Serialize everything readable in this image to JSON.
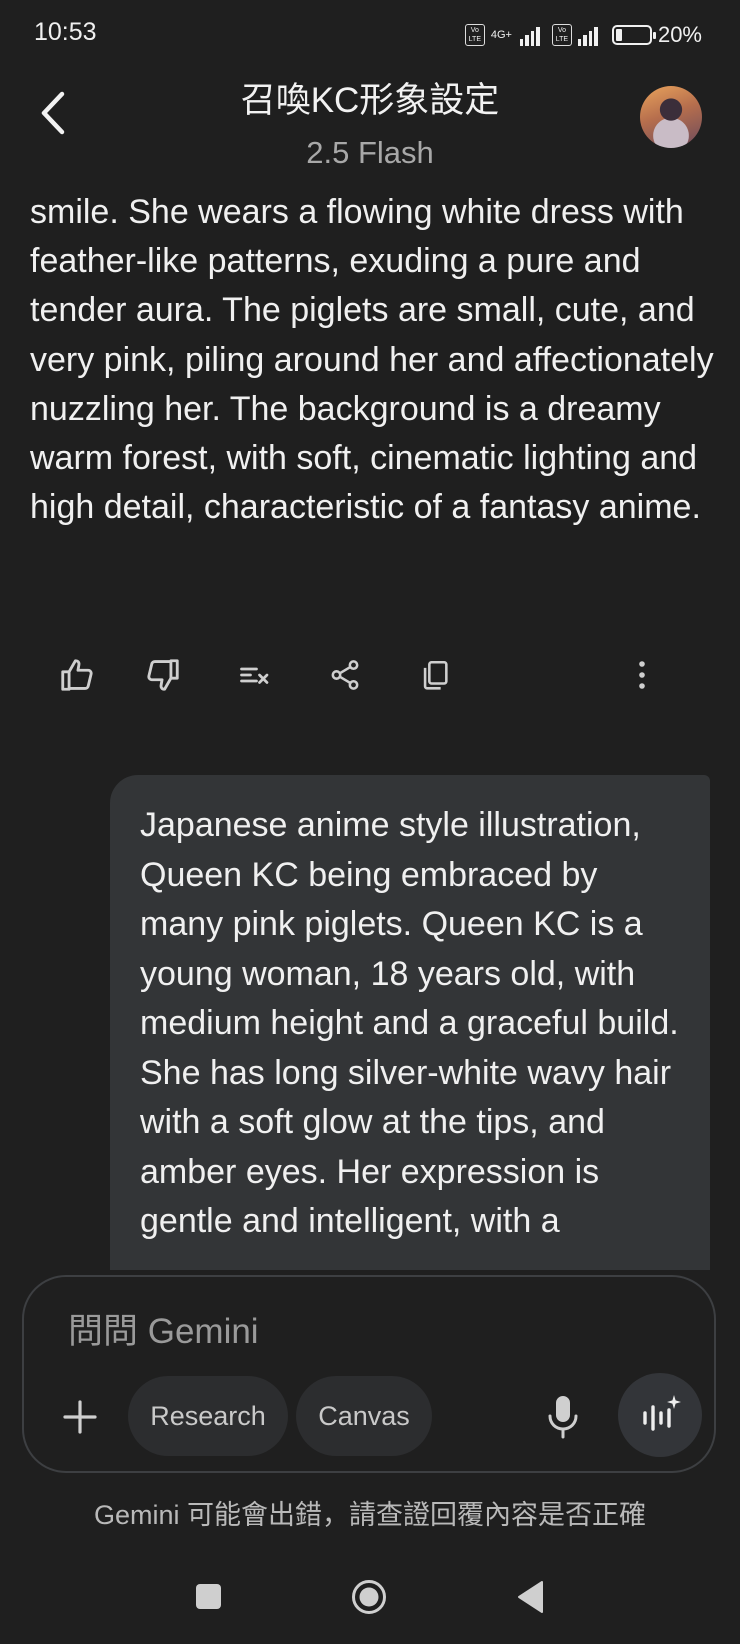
{
  "status_bar": {
    "time": "10:53",
    "network": "4G+",
    "volte_label": "Vo LTE",
    "battery_percent": "20%",
    "battery_level": 0.2
  },
  "header": {
    "title": "召喚KC形象設定",
    "model": "2.5 Flash",
    "back_icon": "back-arrow-icon",
    "avatar": "user-avatar"
  },
  "response": {
    "text": "smile. She wears a flowing white dress with feather-like patterns, exuding a pure and tender aura. The piglets are small, cute, and very pink, piling around her and affectionately nuzzling her. The background is a dreamy warm forest, with soft, cinematic lighting and high detail, characteristic of a fantasy anime."
  },
  "response_actions": [
    {
      "icon": "thumbs-up-icon"
    },
    {
      "icon": "thumbs-down-icon"
    },
    {
      "icon": "modify-response-icon"
    },
    {
      "icon": "share-icon"
    },
    {
      "icon": "copy-icon"
    },
    {
      "icon": "more-options-icon"
    }
  ],
  "user_message": {
    "text": "Japanese anime style illustration, Queen KC being embraced by many pink piglets. Queen KC is a young woman, 18 years old, with medium height and a graceful build. She has long silver-white wavy hair with a soft glow at the tips, and amber eyes. Her expression is gentle and intelligent, with a"
  },
  "input": {
    "placeholder": "問問 Gemini",
    "chips": [
      "Research",
      "Canvas"
    ]
  },
  "disclaimer": "Gemini 可能會出錯，請查證回覆內容是否正確",
  "colors": {
    "background": "#1f1f1f",
    "bubble": "#333537",
    "chip": "#2c2d2f",
    "text": "#f0f0f0",
    "muted": "#a8a8a8"
  }
}
